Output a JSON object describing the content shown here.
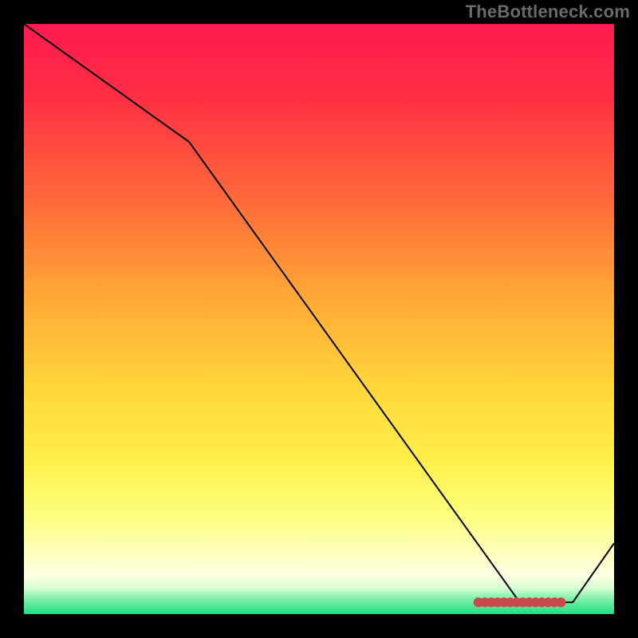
{
  "watermark": "TheBottleneck.com",
  "colors": {
    "background": "#000000",
    "line": "#000000",
    "marker_fill": "#c94a4a",
    "marker_stroke": "#c94a4a",
    "gradient_stops": [
      {
        "offset": 0.0,
        "color": "#ff1a4f"
      },
      {
        "offset": 0.12,
        "color": "#ff2e44"
      },
      {
        "offset": 0.3,
        "color": "#ff6a3a"
      },
      {
        "offset": 0.45,
        "color": "#ffa436"
      },
      {
        "offset": 0.6,
        "color": "#ffd23a"
      },
      {
        "offset": 0.74,
        "color": "#fff04a"
      },
      {
        "offset": 0.83,
        "color": "#fcff7a"
      },
      {
        "offset": 0.9,
        "color": "#feffc0"
      },
      {
        "offset": 0.935,
        "color": "#fdffe4"
      },
      {
        "offset": 0.955,
        "color": "#d9ffd1"
      },
      {
        "offset": 0.975,
        "color": "#7bf0a9"
      },
      {
        "offset": 1.0,
        "color": "#1ee07f"
      }
    ]
  },
  "chart_data": {
    "type": "line",
    "title": "",
    "xlabel": "",
    "ylabel": "",
    "xlim": [
      0,
      100
    ],
    "ylim": [
      0,
      100
    ],
    "x": [
      0,
      28,
      84,
      93,
      100
    ],
    "values": [
      100,
      80,
      2,
      2,
      12
    ],
    "annotations": {
      "marker_cluster_x_range": [
        77,
        91
      ],
      "marker_cluster_y": 2,
      "marker_count_estimate": 14
    }
  }
}
